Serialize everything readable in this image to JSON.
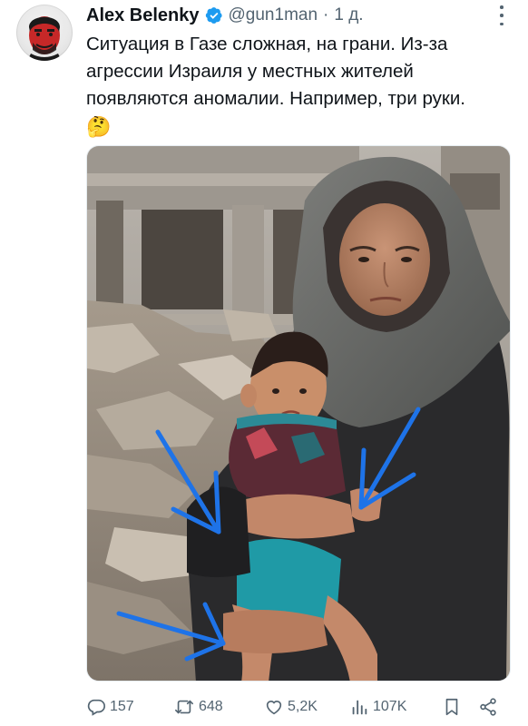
{
  "tweet": {
    "author": {
      "display_name": "Alex Belenky",
      "handle": "@gun1man",
      "separator": "·",
      "time": "1 д.",
      "verified": true
    },
    "text_line": "Ситуация в Газе сложная, на грани. Из-за агрессии Израиля у местных жителей появляются аномалии. Например, три руки.",
    "emoji": "🤔"
  },
  "actions": {
    "replies": "157",
    "reposts": "648",
    "likes": "5,2K",
    "views": "107K"
  },
  "colors": {
    "text": "#0f1419",
    "secondary": "#536471",
    "verified": "#1d9bf0",
    "arrows": "#1e73e8"
  },
  "icons": [
    "verified-icon",
    "more-icon",
    "reply-icon",
    "repost-icon",
    "like-icon",
    "views-icon",
    "bookmark-icon",
    "share-icon"
  ]
}
